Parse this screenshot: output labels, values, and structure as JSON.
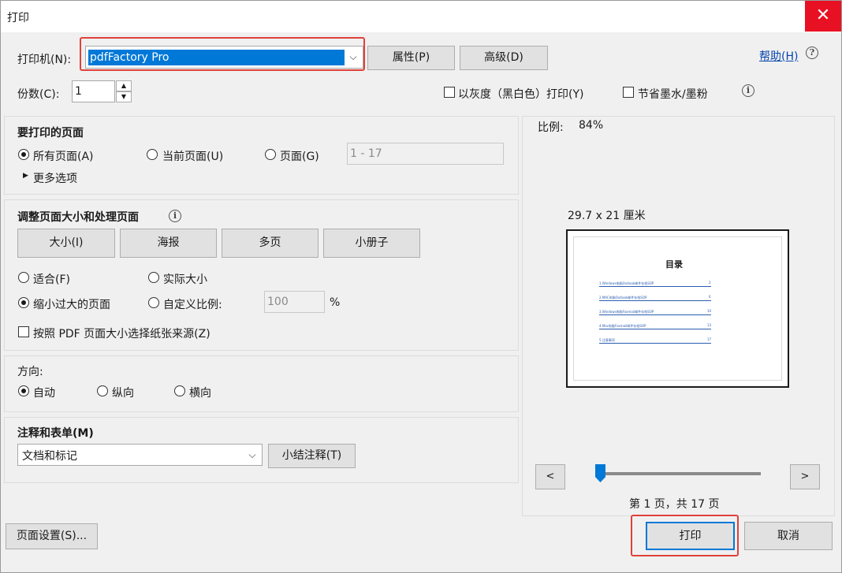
{
  "window": {
    "title": "打印",
    "close_glyph": "✕"
  },
  "printer": {
    "label": "打印机(N):",
    "selected": "pdfFactory Pro",
    "properties_label": "属性(P)",
    "advanced_label": "高级(D)",
    "help_label": "帮助(H)"
  },
  "copies": {
    "label": "份数(C):",
    "value": "1",
    "grayscale_label": "以灰度（黑白色）打印(Y)",
    "grayscale_checked": false,
    "save_ink_label": "节省墨水/墨粉",
    "save_ink_checked": false
  },
  "pages": {
    "title": "要打印的页面",
    "all_label": "所有页面(A)",
    "current_label": "当前页面(U)",
    "range_label": "页面(G)",
    "range_value": "1 - 17",
    "selected": "all",
    "more_options": "更多选项"
  },
  "sizing": {
    "title": "调整页面大小和处理页面",
    "tabs": [
      "大小(I)",
      "海报",
      "多页",
      "小册子"
    ],
    "fit_label": "适合(F)",
    "actual_label": "实际大小",
    "shrink_label": "缩小过大的页面",
    "custom_label": "自定义比例:",
    "custom_value": "100",
    "percent": "%",
    "selected": "shrink",
    "paper_source_label": "按照 PDF 页面大小选择纸张来源(Z)",
    "paper_source_checked": false
  },
  "orientation": {
    "title": "方向:",
    "auto_label": "自动",
    "portrait_label": "纵向",
    "landscape_label": "横向",
    "selected": "auto"
  },
  "comments": {
    "title": "注释和表单(M)",
    "selected": "文档和标记",
    "summarize_label": "小结注释(T)"
  },
  "preview": {
    "scale_label": "比例:",
    "scale_value": "84%",
    "paper_size": "29.7 x 21 厘米",
    "page_heading": "目录",
    "toc": [
      "1.Windows电脑Outlook邮件存档SOP",
      "2.MAC电脑Outlook邮件存档SOP",
      "3.Windows电脑Foxmail邮件存档SOP",
      "4.Mac电脑Foxmail邮件存档SOP",
      "5.注意事项"
    ],
    "toc_pages": [
      "2",
      "6",
      "10",
      "13",
      "17"
    ],
    "prev_label": "<",
    "next_label": ">",
    "page_info": "第 1 页，共 17 页",
    "slider_position": 0
  },
  "footer": {
    "page_setup_label": "页面设置(S)...",
    "print_label": "打印",
    "cancel_label": "取消"
  },
  "colors": {
    "highlight": "#e0413a",
    "accent": "#0078d7",
    "close": "#e81123"
  }
}
